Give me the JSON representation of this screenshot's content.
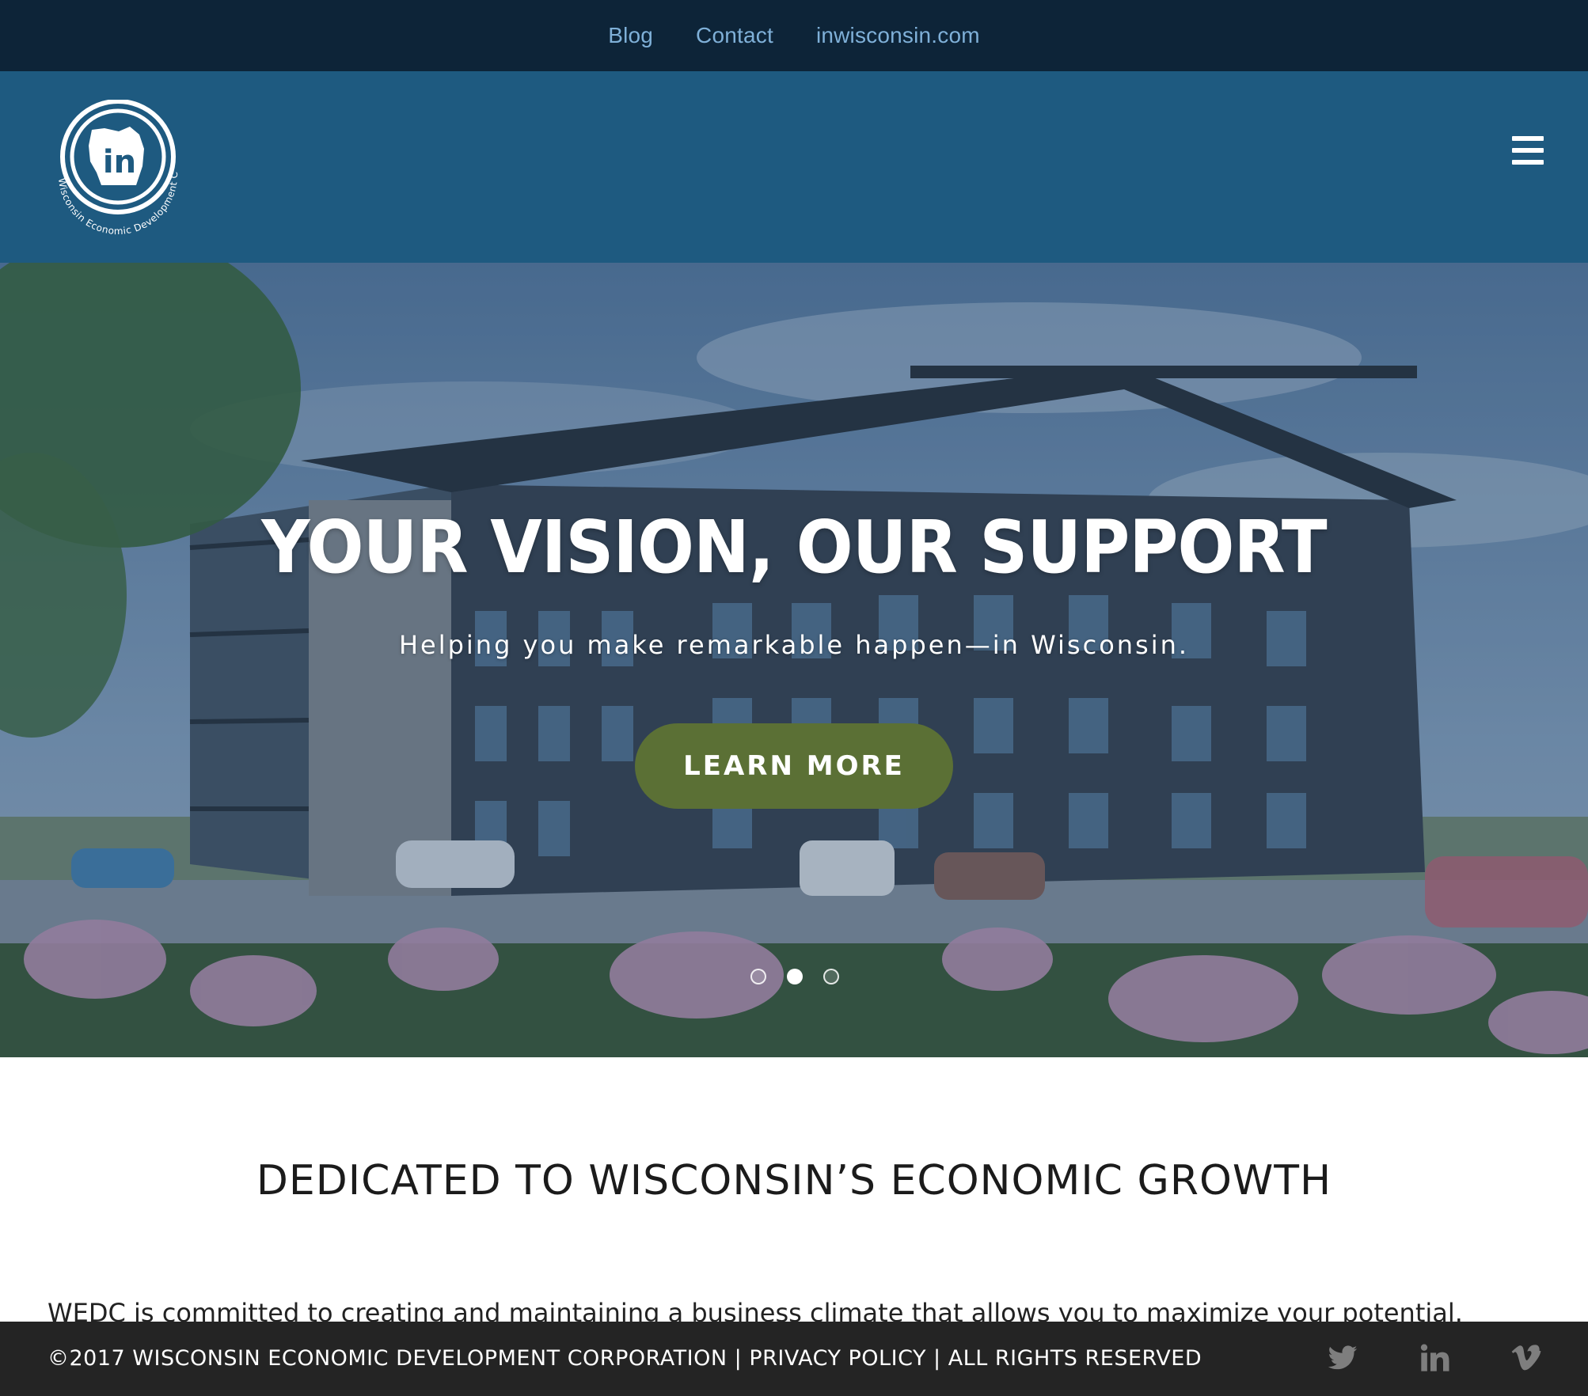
{
  "top_nav": {
    "links": [
      "Blog",
      "Contact",
      "inwisconsin.com"
    ]
  },
  "header": {
    "logo_icon": "wisconsin-in-logo",
    "logo_mark_text": "in",
    "logo_ring_text": "Wisconsin Economic Development Corporation",
    "menu_icon": "hamburger-menu-icon"
  },
  "hero": {
    "title": "YOUR VISION, OUR SUPPORT",
    "subtitle": "Helping you make remarkable happen—in Wisconsin.",
    "cta_label": "LEARN MORE",
    "slide_count": 3,
    "active_slide": 2
  },
  "intro": {
    "heading": "DEDICATED TO WISCONSIN’S ECONOMIC GROWTH",
    "body": "WEDC is committed to creating and maintaining a business climate that allows you to maximize your potential."
  },
  "footer": {
    "copyright": "©2017 WISCONSIN ECONOMIC DEVELOPMENT CORPORATION",
    "separator": " | ",
    "privacy_label": "PRIVACY POLICY",
    "rights_label": "ALL RIGHTS RESERVED",
    "social_icons": [
      "twitter-icon",
      "linkedin-icon",
      "vimeo-icon"
    ]
  },
  "colors": {
    "topbar": "#0d2438",
    "header": "#1e5a80",
    "cta": "#5b7035",
    "footer": "#242424",
    "nav_link": "#7fb0d8"
  }
}
